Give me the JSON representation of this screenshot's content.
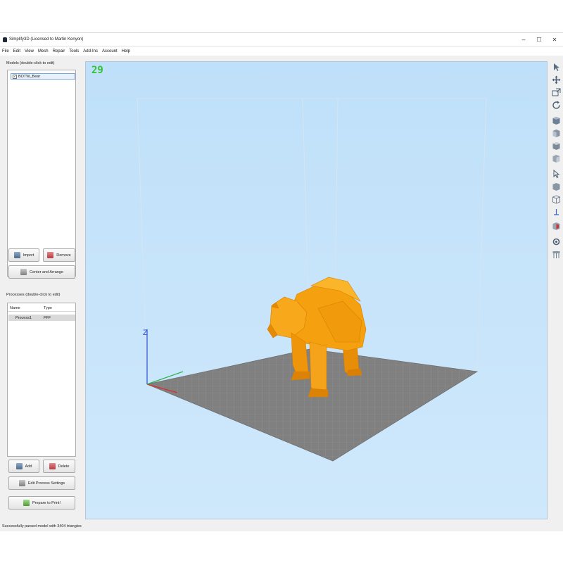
{
  "window": {
    "title": "Simplify3D (Licensed to Martin Kenyon)",
    "controls": {
      "minimize": "–",
      "maximize": "☐",
      "close": "✕"
    }
  },
  "menu": [
    "File",
    "Edit",
    "View",
    "Mesh",
    "Repair",
    "Tools",
    "Add-Ins",
    "Account",
    "Help"
  ],
  "models": {
    "label": "Models (double-click to edit)",
    "items": [
      {
        "name": "BOTW_Bear",
        "checked": true
      }
    ],
    "import_label": "Import",
    "remove_label": "Remove",
    "center_label": "Center and Arrange"
  },
  "processes": {
    "label": "Processes (double-click to edit)",
    "columns": [
      "Name",
      "Type"
    ],
    "rows": [
      {
        "name": "Process1",
        "type": "FFF"
      }
    ],
    "add_label": "Add",
    "delete_label": "Delete",
    "edit_label": "Edit Process Settings",
    "prepare_label": "Prepare to Print!"
  },
  "viewport": {
    "fps": "29",
    "axis_label": "Z",
    "model_color": "#f5a00f",
    "bed_color": "#7e7e7e",
    "background_color": "#c4e3fb"
  },
  "toolbar": {
    "tools": [
      "select-arrow-icon",
      "move-icon",
      "zoom-icon",
      "rotate-icon",
      "view-default-icon",
      "view-front-icon",
      "view-top-icon",
      "view-side-icon",
      "select-object-icon",
      "solid-view-icon",
      "wireframe-view-icon",
      "z-axis-icon",
      "cross-section-icon",
      "settings-icon",
      "build-table-icon"
    ]
  },
  "status": "Successfully parsed model with 3404 triangles"
}
